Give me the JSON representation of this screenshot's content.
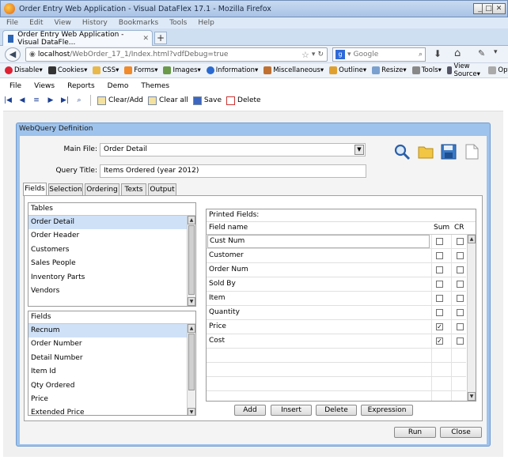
{
  "browser": {
    "window_title": "Order Entry Web Application - Visual DataFlex 17.1 - Mozilla Firefox",
    "menu": [
      "File",
      "Edit",
      "View",
      "History",
      "Bookmarks",
      "Tools",
      "Help"
    ],
    "tab_title": "Order Entry Web Application - Visual DataFle...",
    "url_host": "localhost",
    "url_path": "/WebOrder_17_1/Index.html?vdfDebug=true",
    "search_placeholder": "Google",
    "webdev_toolbar": [
      "Disable▾",
      "Cookies▾",
      "CSS▾",
      "Forms▾",
      "Images▾",
      "Information▾",
      "Miscellaneous▾",
      "Outline▾",
      "Resize▾",
      "Tools▾",
      "View Source▾",
      "Optic"
    ]
  },
  "app": {
    "menu": [
      "File",
      "Views",
      "Reports",
      "Demo",
      "Themes"
    ],
    "toolbar": {
      "clear_add": "Clear/Add",
      "clear_all": "Clear all",
      "save": "Save",
      "delete": "Delete"
    }
  },
  "panel": {
    "title": "WebQuery Definition",
    "main_file_label": "Main File:",
    "main_file_value": "Order Detail",
    "query_title_label": "Query Title:",
    "query_title_value": "Items Ordered (year 2012)",
    "tabs": [
      "Fields",
      "Selection",
      "Ordering",
      "Texts",
      "Output"
    ],
    "active_tab": "Fields",
    "tables": {
      "header": "Tables",
      "items": [
        "Order Detail",
        "Order Header",
        "Customers",
        "Sales People",
        "Inventory Parts",
        "Vendors"
      ],
      "selected": 0
    },
    "fields": {
      "header": "Fields",
      "items": [
        "Recnum",
        "Order Number",
        "Detail Number",
        "Item Id",
        "Qty Ordered",
        "Price",
        "Extended Price"
      ],
      "selected": 0
    },
    "printed": {
      "title": "Printed Fields:",
      "col_name": "Field name",
      "col_sum": "Sum",
      "col_cr": "CR",
      "rows": [
        {
          "name": "Cust Num",
          "sum": false,
          "cr": false
        },
        {
          "name": "Customer",
          "sum": false,
          "cr": false
        },
        {
          "name": "Order Num",
          "sum": false,
          "cr": false
        },
        {
          "name": "Sold By",
          "sum": false,
          "cr": false
        },
        {
          "name": "Item",
          "sum": false,
          "cr": false
        },
        {
          "name": "Quantity",
          "sum": false,
          "cr": false
        },
        {
          "name": "Price",
          "sum": true,
          "cr": false
        },
        {
          "name": "Cost",
          "sum": true,
          "cr": false
        }
      ]
    },
    "buttons": {
      "add": "Add",
      "insert": "Insert",
      "delete": "Delete",
      "expression": "Expression",
      "run": "Run",
      "close": "Close"
    }
  },
  "colors": {
    "panel_border": "#9ec3ec",
    "selection": "#cfe1f7"
  }
}
